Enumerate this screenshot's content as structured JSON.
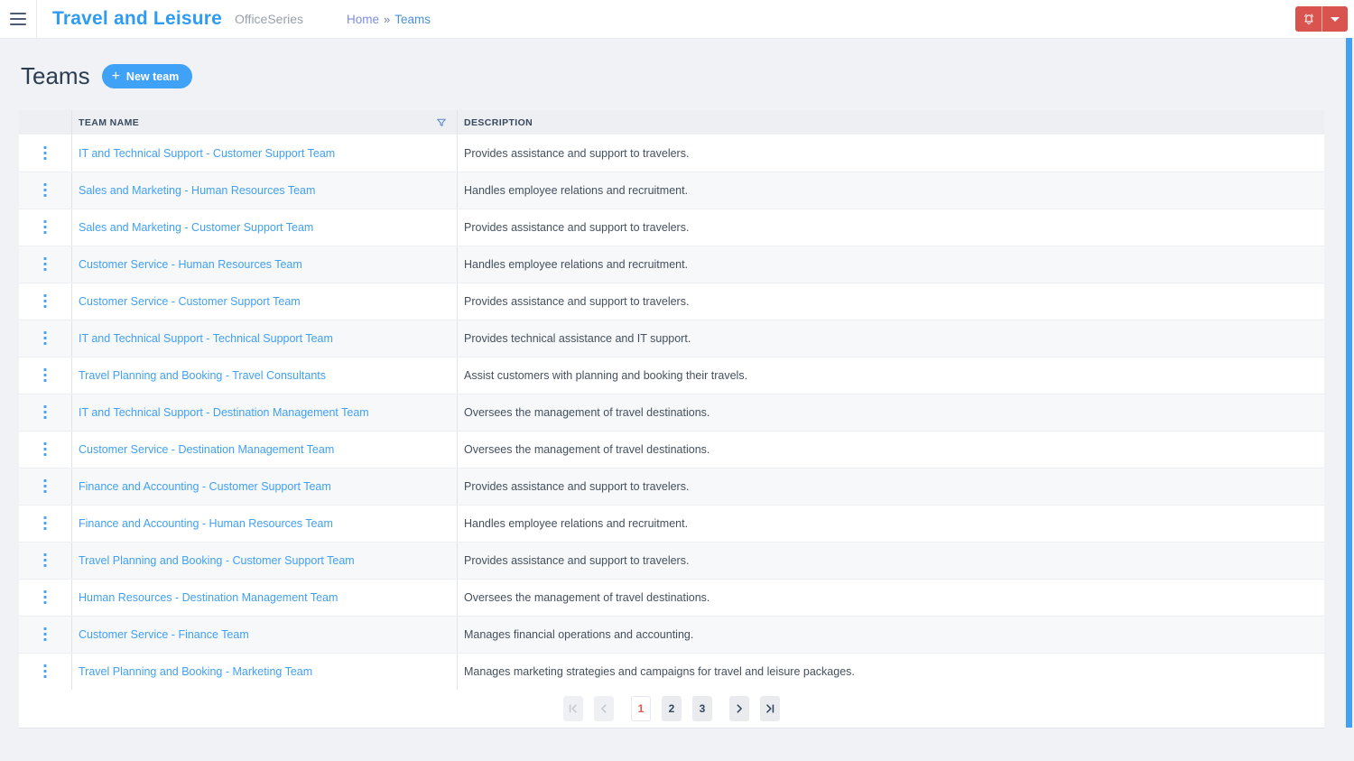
{
  "topbar": {
    "title": "Travel and Leisure",
    "subtitle": "OfficeSeries",
    "breadcrumb": {
      "home": "Home",
      "separator": "»",
      "current": "Teams"
    }
  },
  "icons": {
    "menu": "menu-icon",
    "bell": "notifications-bell-icon",
    "caret": "caret-down-icon",
    "plus": "+",
    "kebab": "kebab-menu-icon",
    "filter": "filter-funnel-icon"
  },
  "colors": {
    "accent_blue": "#3fa2f7",
    "link_blue": "#41a0f3",
    "title_blue": "#2e9cf4",
    "danger_red": "#d9534f",
    "active_page_red": "#e2574c",
    "scrollbar_blue": "#42a1f5",
    "page_bg": "#f0f2f5"
  },
  "page": {
    "title": "Teams",
    "new_team_label": "New team"
  },
  "table": {
    "columns": [
      {
        "label": "TEAM NAME"
      },
      {
        "label": "DESCRIPTION"
      }
    ],
    "rows": [
      {
        "name": "IT and Technical Support - Customer Support Team",
        "description": "Provides assistance and support to travelers."
      },
      {
        "name": "Sales and Marketing - Human Resources Team",
        "description": "Handles employee relations and recruitment."
      },
      {
        "name": "Sales and Marketing - Customer Support Team",
        "description": "Provides assistance and support to travelers."
      },
      {
        "name": "Customer Service - Human Resources Team",
        "description": "Handles employee relations and recruitment."
      },
      {
        "name": "Customer Service - Customer Support Team",
        "description": "Provides assistance and support to travelers."
      },
      {
        "name": "IT and Technical Support - Technical Support Team",
        "description": "Provides technical assistance and IT support."
      },
      {
        "name": "Travel Planning and Booking - Travel Consultants",
        "description": "Assist customers with planning and booking their travels."
      },
      {
        "name": "IT and Technical Support - Destination Management Team",
        "description": "Oversees the management of travel destinations."
      },
      {
        "name": "Customer Service - Destination Management Team",
        "description": "Oversees the management of travel destinations."
      },
      {
        "name": "Finance and Accounting - Customer Support Team",
        "description": "Provides assistance and support to travelers."
      },
      {
        "name": "Finance and Accounting - Human Resources Team",
        "description": "Handles employee relations and recruitment."
      },
      {
        "name": "Travel Planning and Booking - Customer Support Team",
        "description": "Provides assistance and support to travelers."
      },
      {
        "name": "Human Resources - Destination Management Team",
        "description": "Oversees the management of travel destinations."
      },
      {
        "name": "Customer Service - Finance Team",
        "description": "Manages financial operations and accounting."
      },
      {
        "name": "Travel Planning and Booking - Marketing Team",
        "description": "Manages marketing strategies and campaigns for travel and leisure packages."
      }
    ]
  },
  "pagination": {
    "pages": [
      "1",
      "2",
      "3"
    ],
    "current": "1"
  }
}
